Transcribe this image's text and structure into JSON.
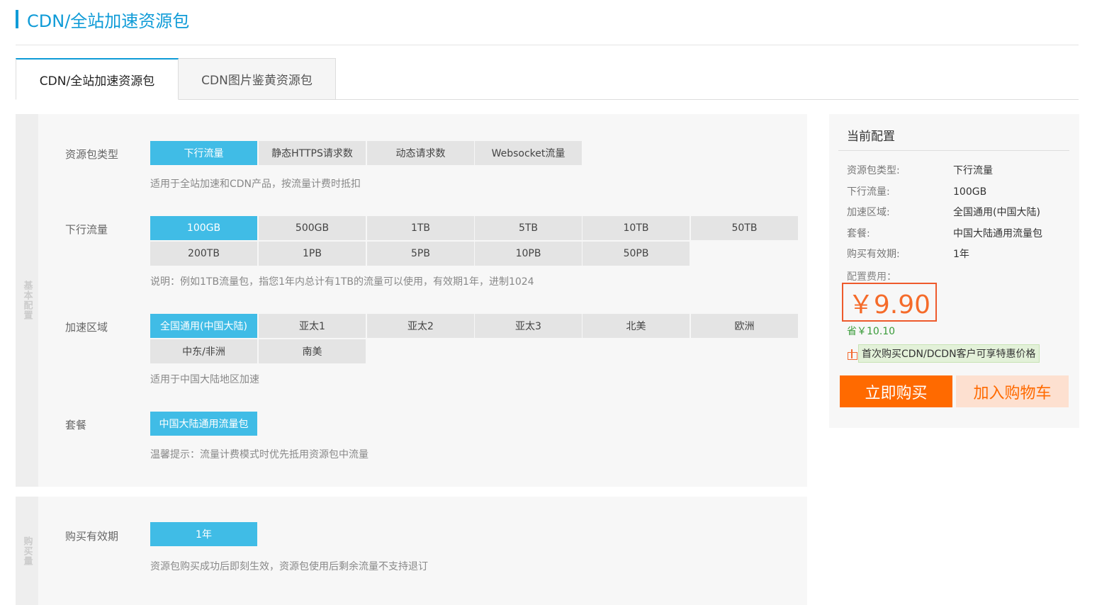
{
  "header": {
    "title": "CDN/全站加速资源包"
  },
  "tabs": [
    {
      "label": "CDN/全站加速资源包",
      "active": true
    },
    {
      "label": "CDN图片鉴黄资源包",
      "active": false
    }
  ],
  "basic": {
    "section_label": "基本配置",
    "package_type": {
      "label": "资源包类型",
      "options": [
        "下行流量",
        "静态HTTPS请求数",
        "动态请求数",
        "Websocket流量"
      ],
      "selected": "下行流量",
      "hint": "适用于全站加速和CDN产品，按流量计费时抵扣"
    },
    "traffic": {
      "label": "下行流量",
      "options": [
        "100GB",
        "500GB",
        "1TB",
        "5TB",
        "10TB",
        "50TB",
        "200TB",
        "1PB",
        "5PB",
        "10PB",
        "50PB"
      ],
      "selected": "100GB",
      "hint": "说明：例如1TB流量包，指您1年内总计有1TB的流量可以使用，有效期1年，进制1024"
    },
    "region": {
      "label": "加速区域",
      "options": [
        "全国通用(中国大陆)",
        "亚太1",
        "亚太2",
        "亚太3",
        "北美",
        "欧洲",
        "中东/非洲",
        "南美"
      ],
      "selected": "全国通用(中国大陆)",
      "hint": "适用于中国大陆地区加速"
    },
    "plan": {
      "label": "套餐",
      "options": [
        "中国大陆通用流量包"
      ],
      "selected": "中国大陆通用流量包",
      "hint": "温馨提示：流量计费模式时优先抵用资源包中流量"
    }
  },
  "duration": {
    "section_label": "购买量",
    "label": "购买有效期",
    "options": [
      "1年"
    ],
    "selected": "1年",
    "hint": "资源包购买成功后即刻生效，资源包使用后剩余流量不支持退订"
  },
  "summary": {
    "title": "当前配置",
    "rows": [
      {
        "key": "资源包类型:",
        "value": "下行流量"
      },
      {
        "key": "下行流量:",
        "value": "100GB"
      },
      {
        "key": "加速区域:",
        "value": "全国通用(中国大陆)"
      },
      {
        "key": "套餐:",
        "value": "中国大陆通用流量包"
      },
      {
        "key": "购买有效期:",
        "value": "1年"
      }
    ],
    "fee_label": "配置费用：",
    "price": "￥9.90",
    "save": "省￥10.10",
    "promo": "首次购买CDN/DCDN客户可享特惠价格",
    "buy_label": "立即购买",
    "cart_label": "加入购物车"
  },
  "colors": {
    "accent": "#0f9bd7",
    "selected": "#40bce6",
    "price": "#f56b2a",
    "buy": "#ff6a00"
  }
}
